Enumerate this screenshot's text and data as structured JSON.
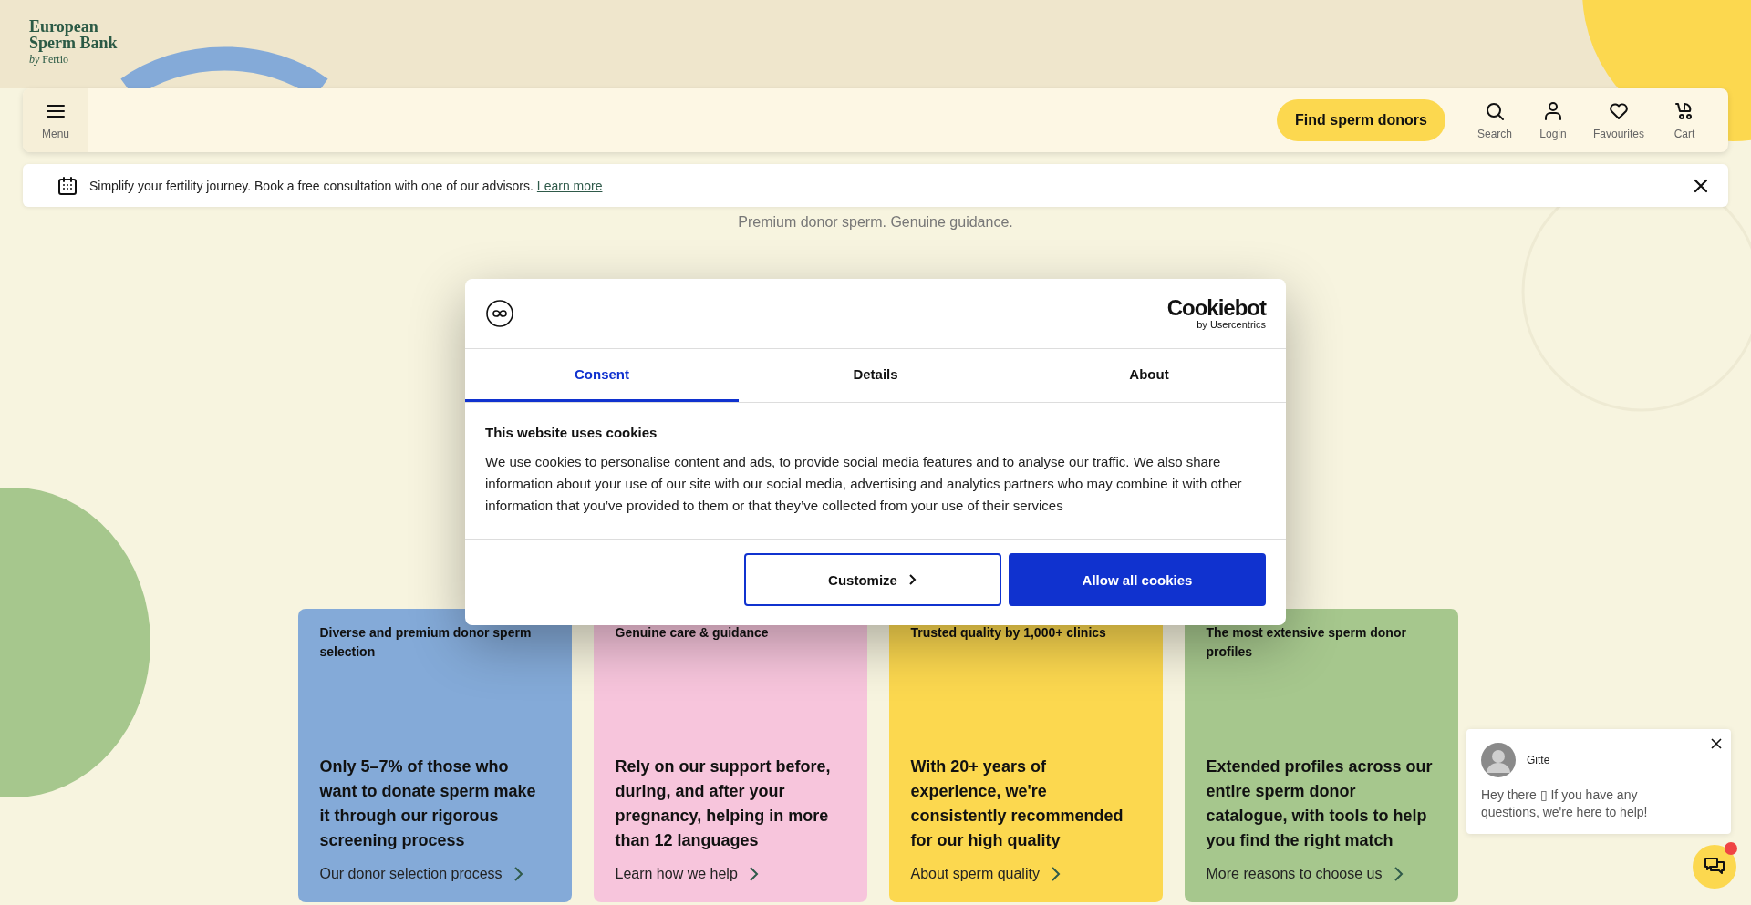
{
  "logo": {
    "line_1": "European",
    "line_2": "Sperm Bank",
    "byline": "*by* Fertio"
  },
  "header": {
    "menu_label": "Menu",
    "cta": "Find sperm donors",
    "actions": [
      {
        "label": "Search",
        "kind": "search"
      },
      {
        "label": "Login",
        "kind": "login"
      },
      {
        "label": "Favourites",
        "kind": "favourites"
      },
      {
        "label": "Cart",
        "kind": "cart"
      }
    ]
  },
  "banner": {
    "text": "Simplify your fertility journey. Book a free consultation with one of our advisors.",
    "link": "Learn more"
  },
  "tagline": "Premium donor sperm. Genuine guidance.",
  "cards": [
    {
      "title": "Diverse and premium donor sperm selection",
      "text": "Only 5–7% of those who want to donate sperm make it through our rigorous screening process",
      "link": "Our donor selection process",
      "color": "#84aad8"
    },
    {
      "title": "Genuine care & guidance",
      "text": "Rely on our support before, during, and after your pregnancy, helping in more than 12 languages",
      "link": "Learn how we help",
      "color": "#f7c5dc"
    },
    {
      "title": "Trusted quality by 1,000+ clinics",
      "text": "With 20+ years of experience, we're consistently recommended for our high quality",
      "link": "About sperm quality",
      "color": "#fcd84f"
    },
    {
      "title": "The most extensive sperm donor profiles",
      "text": "Extended profiles across our entire sperm donor catalogue, with tools to help you find the right match",
      "link": "More reasons to choose us",
      "color": "#a6c78d"
    }
  ],
  "cookie_dialog": {
    "brand": "Cookiebot",
    "brand_sub": "by Usercentrics",
    "tabs": [
      {
        "label": "Consent",
        "selected": true
      },
      {
        "label": "Details",
        "selected": false
      },
      {
        "label": "About",
        "selected": false
      }
    ],
    "heading": "This website uses cookies",
    "text": "We use cookies to personalise content and ads, to provide social media features and to analyse our traffic. We also share information about your use of our site with our social media, advertising and analytics partners who may combine it with other information that you’ve provided to them or that they’ve collected from your use of their services",
    "buttons": [
      {
        "label": "Customize",
        "kind": "outline"
      },
      {
        "label": "Allow all cookies",
        "kind": "primary"
      }
    ]
  },
  "chat": {
    "agent": "Gitte",
    "message": "Hey there ▯ If you have any questions, we're here to help!",
    "unread": true
  }
}
